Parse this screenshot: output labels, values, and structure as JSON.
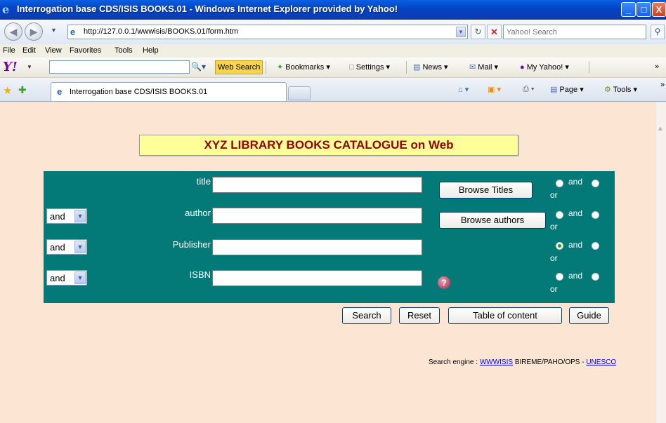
{
  "window": {
    "title": "Interrogation base CDS/ISIS BOOKS.01 - Windows Internet Explorer provided by Yahoo!",
    "controls": {
      "minimize": "_",
      "maximize": "□",
      "close": "X"
    }
  },
  "address_bar": {
    "url": "http://127.0.0.1/wwwisis/BOOKS.01/form.htm",
    "search_placeholder": "Yahoo! Search"
  },
  "menu": [
    "File",
    "Edit",
    "View",
    "Favorites",
    "Tools",
    "Help"
  ],
  "yahoo_toolbar": {
    "logo": "Y!",
    "web_search_label": "Web Search",
    "items": [
      "Bookmarks ▾",
      "Settings ▾",
      "News ▾",
      "Mail ▾",
      "My Yahoo! ▾"
    ],
    "overflow": "»"
  },
  "tabs": [
    {
      "label": "Interrogation base CDS/ISIS BOOKS.01",
      "active": true
    }
  ],
  "tab_tools": {
    "page": "Page ▾",
    "tools": "Tools ▾",
    "overflow": "»"
  },
  "page": {
    "banner": "XYZ LIBRARY BOOKS CATALOGUE on Web",
    "fields": [
      {
        "label": "title",
        "operator": "",
        "value": "",
        "button": "Browse Titles",
        "selected_radio": ""
      },
      {
        "label": "author",
        "operator": "and",
        "value": "",
        "button": "Browse authors",
        "selected_radio": ""
      },
      {
        "label": "Publisher",
        "operator": "and",
        "value": "",
        "button": "",
        "selected_radio": "and"
      },
      {
        "label": "ISBN",
        "operator": "and",
        "value": "",
        "button": "",
        "selected_radio": ""
      }
    ],
    "radio_labels": {
      "and": "and",
      "or": "or"
    },
    "actions": {
      "search": "Search",
      "reset": "Reset",
      "toc": "Table of content",
      "guide": "Guide"
    },
    "footer": {
      "prefix": "Search engine : ",
      "link1": "WWWISIS",
      "middle": " BIREME/PAHO/OPS - ",
      "link2": "UNESCO"
    }
  },
  "colors": {
    "page_bg": "#fce6d3",
    "form_panel": "#037a78",
    "banner_bg": "#ffff99",
    "banner_text": "#990000"
  }
}
